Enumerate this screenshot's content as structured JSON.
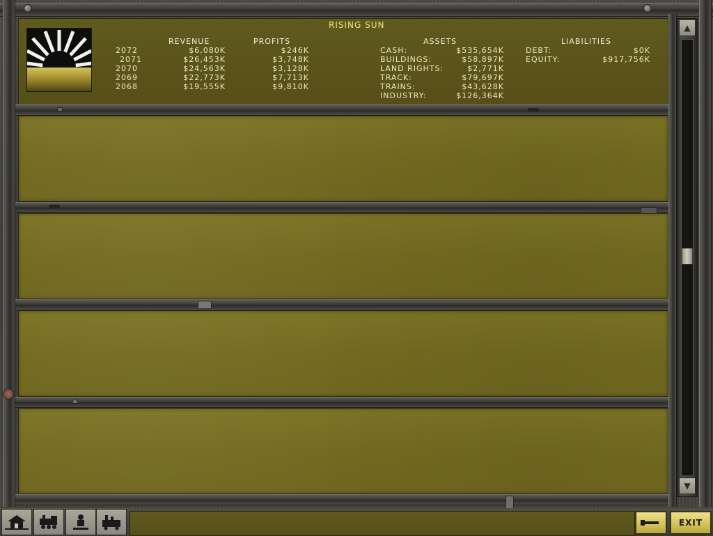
{
  "company": {
    "name": "RISING SUN"
  },
  "revenue": {
    "header_revenue": "Revenue",
    "header_profits": "Profits",
    "rows": [
      {
        "year": "2072",
        "revenue": "$6,080K",
        "profits": "$246K"
      },
      {
        "year": "2071",
        "revenue": "$26,453K",
        "profits": "$3,748K"
      },
      {
        "year": "2070",
        "revenue": "$24,563K",
        "profits": "$3,128K"
      },
      {
        "year": "2069",
        "revenue": "$22,773K",
        "profits": "$7,713K"
      },
      {
        "year": "2068",
        "revenue": "$19,555K",
        "profits": "$9,810K"
      }
    ]
  },
  "assets": {
    "header": "Assets",
    "rows": [
      {
        "label": "Cash:",
        "value": "$535,654K"
      },
      {
        "label": "Buildings:",
        "value": "$58,897K"
      },
      {
        "label": "Land Rights:",
        "value": "$2,771K"
      },
      {
        "label": "Track:",
        "value": "$79,697K"
      },
      {
        "label": "Trains:",
        "value": "$43,628K"
      },
      {
        "label": "Industry:",
        "value": "$126,364K"
      }
    ]
  },
  "liabilities": {
    "header": "Liabilities",
    "rows": [
      {
        "label": "Debt:",
        "value": "$0K"
      },
      {
        "label": "Equity:",
        "value": "$917,756K"
      }
    ]
  },
  "toolbar": {
    "exit_label": "EXIT",
    "tools": [
      {
        "icon": "station-icon"
      },
      {
        "icon": "locomotive-icon"
      },
      {
        "icon": "person-icon"
      },
      {
        "icon": "industry-icon"
      }
    ]
  },
  "scrollbar": {
    "up_glyph": "▲",
    "down_glyph": "▼",
    "position": 0.5
  },
  "colors": {
    "panel": "#736b20",
    "title": "#f2e47e",
    "text": "#efe7c0",
    "button": "#d4c158"
  }
}
